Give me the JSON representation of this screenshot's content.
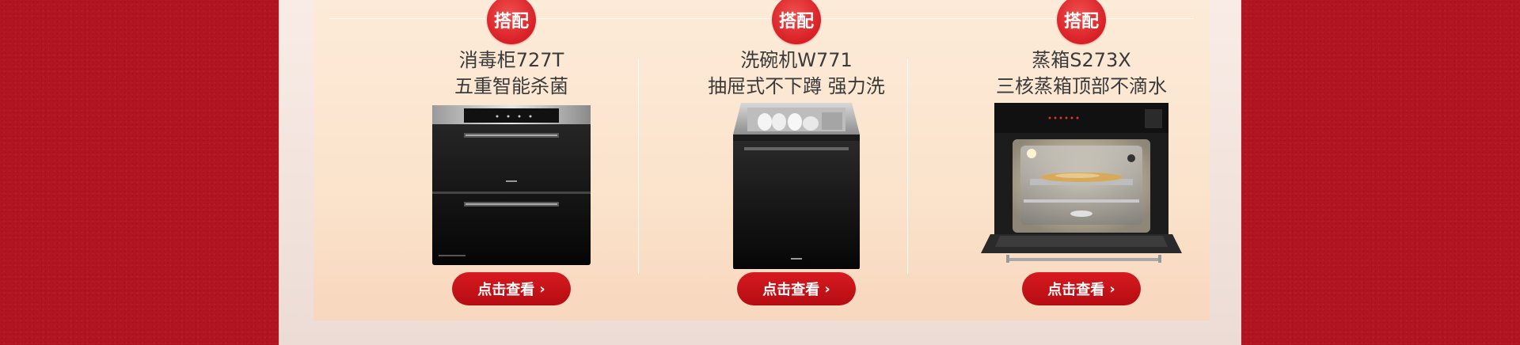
{
  "products": [
    {
      "badge": "搭配",
      "title": "消毒柜727T",
      "subtitle": "五重智能杀菌",
      "button": "点击查看",
      "icon": "sterilizer-cabinet"
    },
    {
      "badge": "搭配",
      "title": "洗碗机W771",
      "subtitle": "抽屉式不下蹲 强力洗",
      "button": "点击查看",
      "icon": "dishwasher-drawer"
    },
    {
      "badge": "搭配",
      "title": "蒸箱S273X",
      "subtitle": "三核蒸箱顶部不滴水",
      "button": "点击查看",
      "icon": "steam-oven-open"
    }
  ],
  "colors": {
    "background_red": "#b31421",
    "panel_peach": "#fbe3cc",
    "badge_red": "#d81f25",
    "button_red": "#c4141a",
    "text_dark": "#3a3a3a"
  }
}
